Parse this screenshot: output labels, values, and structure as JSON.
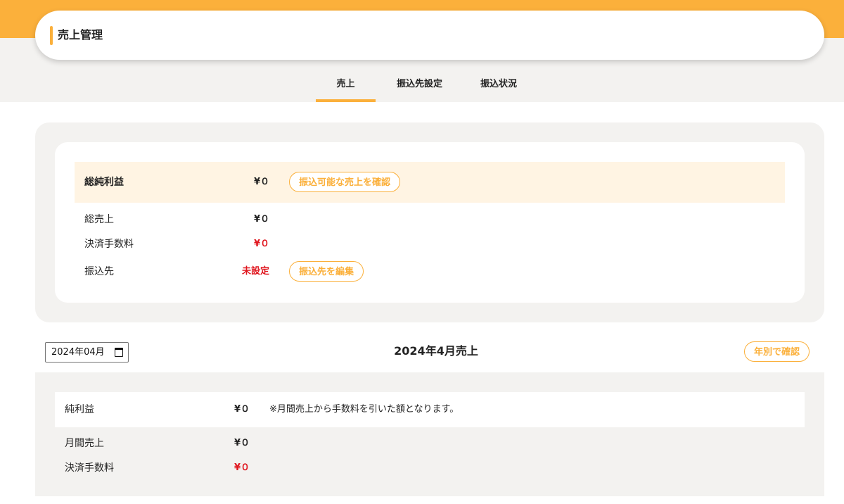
{
  "header": {
    "title": "売上管理"
  },
  "tabs": [
    {
      "label": "売上",
      "active": true
    },
    {
      "label": "振込先設定",
      "active": false
    },
    {
      "label": "振込状況",
      "active": false
    }
  ],
  "summary": {
    "net_profit_total": {
      "label": "総純利益",
      "value": "¥０"
    },
    "check_button": "振込可能な売上を確認",
    "total_sales": {
      "label": "総売上",
      "value": "¥０"
    },
    "fee": {
      "label": "決済手数料",
      "value": "¥０"
    },
    "payee": {
      "label": "振込先",
      "value": "未設定"
    },
    "edit_payee_button": "振込先を編集"
  },
  "month_picker": {
    "value": "2024年04月"
  },
  "monthly": {
    "title": "2024年4月売上",
    "year_button": "年別で確認",
    "net_profit": {
      "label": "純利益",
      "value": "¥０",
      "note": "※月間売上から手数料を引いた額となります。"
    },
    "sales": {
      "label": "月間売上",
      "value": "¥０"
    },
    "fee": {
      "label": "決済手数料",
      "value": "¥０"
    }
  },
  "colors": {
    "accent": "#fbb03b",
    "negative": "#e0161e",
    "highlight_bg": "#fff4e3",
    "panel_bg": "#f3f2f0"
  }
}
